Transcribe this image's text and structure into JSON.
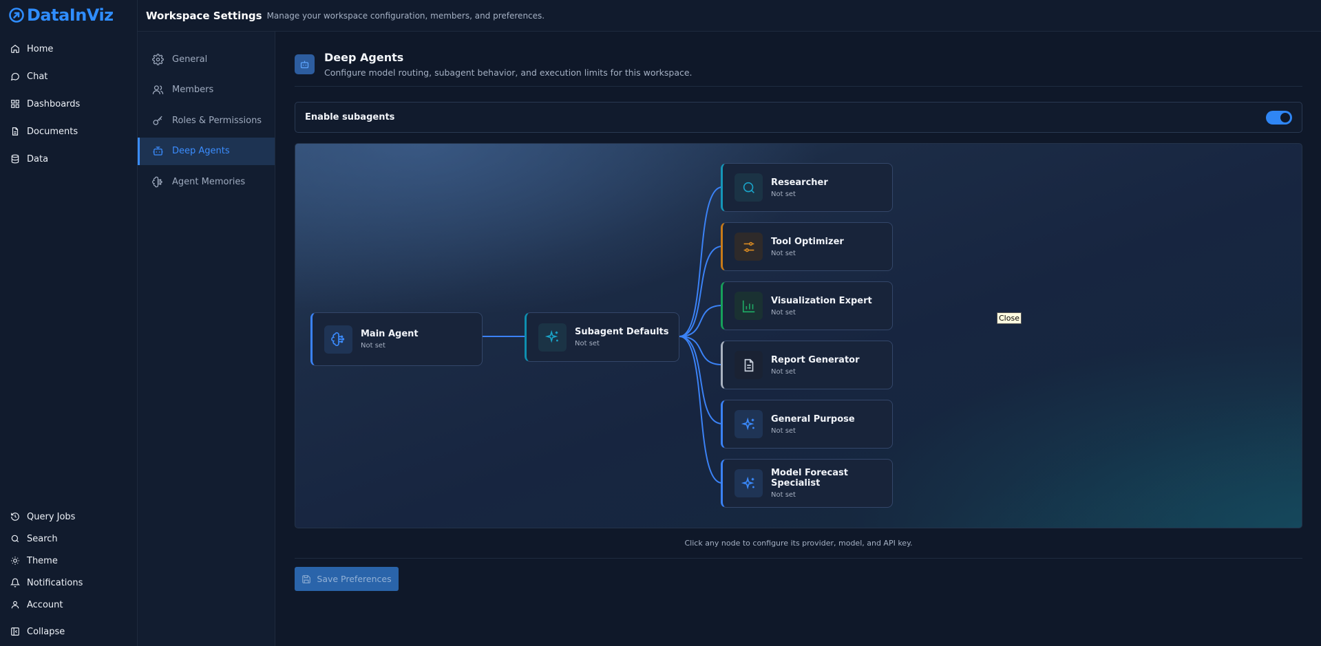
{
  "app": {
    "logo_text": "DataInViz"
  },
  "sidebar": {
    "items": [
      {
        "label": "Home",
        "icon": "home-icon"
      },
      {
        "label": "Chat",
        "icon": "chat-icon"
      },
      {
        "label": "Dashboards",
        "icon": "dashboards-icon"
      },
      {
        "label": "Documents",
        "icon": "document-icon"
      },
      {
        "label": "Data",
        "icon": "database-icon"
      }
    ],
    "bottom_items": [
      {
        "label": "Query Jobs",
        "icon": "history-icon"
      },
      {
        "label": "Search",
        "icon": "search-icon"
      },
      {
        "label": "Theme",
        "icon": "sun-icon"
      },
      {
        "label": "Notifications",
        "icon": "bell-icon"
      },
      {
        "label": "Account",
        "icon": "user-icon"
      },
      {
        "label": "Collapse",
        "icon": "collapse-icon"
      }
    ]
  },
  "header": {
    "title": "Workspace Settings",
    "subtitle": "Manage your workspace configuration, members, and preferences."
  },
  "settings_nav": {
    "items": [
      {
        "label": "General",
        "icon": "gear-icon",
        "active": false
      },
      {
        "label": "Members",
        "icon": "users-icon",
        "active": false
      },
      {
        "label": "Roles & Permissions",
        "icon": "key-icon",
        "active": false
      },
      {
        "label": "Deep Agents",
        "icon": "bot-icon",
        "active": true
      },
      {
        "label": "Agent Memories",
        "icon": "brain-icon",
        "active": false
      }
    ]
  },
  "main": {
    "title": "Deep Agents",
    "description": "Configure model routing, subagent behavior, and execution limits for this workspace.",
    "toggle": {
      "label": "Enable subagents",
      "enabled": true
    },
    "hint": "Click any node to configure its provider, model, and API key.",
    "save_label": "Save Preferences",
    "tooltip": "Close"
  },
  "graph": {
    "main_agent": {
      "title": "Main Agent",
      "status": "Not set",
      "icon": "brain-icon",
      "accent": "#3b82f6"
    },
    "defaults": {
      "title": "Subagent Defaults",
      "status": "Not set",
      "icon": "sparkles-icon",
      "accent": "#0e8fb0"
    },
    "subagents": [
      {
        "title": "Researcher",
        "status": "Not set",
        "icon": "search-icon",
        "accent": "#1596b8",
        "icon_color": "#1aa3c8",
        "icon_bg": "#1b3345"
      },
      {
        "title": "Tool Optimizer",
        "status": "Not set",
        "icon": "sliders-icon",
        "accent": "#c87a18",
        "icon_color": "#d98a22",
        "icon_bg": "#2e2a2a"
      },
      {
        "title": "Visualization Expert",
        "status": "Not set",
        "icon": "bar-chart-icon",
        "accent": "#17a05a",
        "icon_color": "#1ea864",
        "icon_bg": "#1a3132"
      },
      {
        "title": "Report Generator",
        "status": "Not set",
        "icon": "file-text-icon",
        "accent": "#a9b2c0",
        "icon_color": "#c7cfdb",
        "icon_bg": "#1a2233"
      },
      {
        "title": "General Purpose",
        "status": "Not set",
        "icon": "sparkles-icon",
        "accent": "#3b82f6",
        "icon_color": "#3b8bff",
        "icon_bg": "#1f3455"
      },
      {
        "title": "Model Forecast Specialist",
        "status": "Not set",
        "icon": "sparkles-icon",
        "accent": "#3b82f6",
        "icon_color": "#3b8bff",
        "icon_bg": "#1f3455"
      }
    ]
  }
}
